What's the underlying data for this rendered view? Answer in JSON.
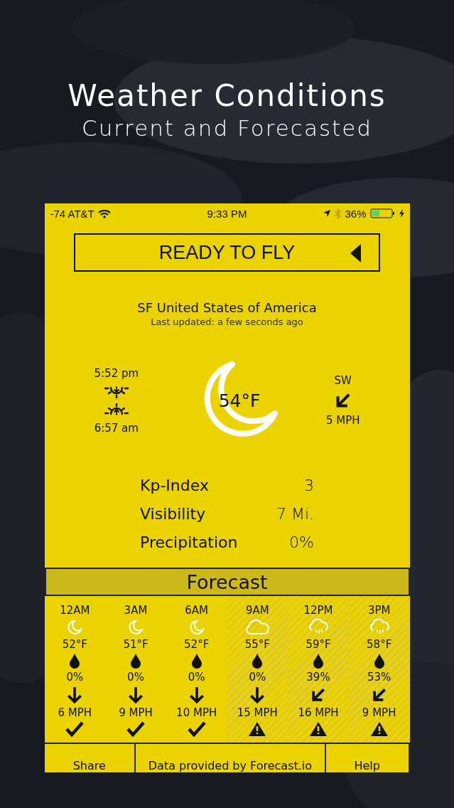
{
  "header": {
    "title": "Weather Conditions",
    "subtitle": "Current and Forecasted"
  },
  "status_bar": {
    "carrier": "-74 AT&T",
    "time": "9:33 PM",
    "battery": "36%"
  },
  "ready_button": {
    "label": "READY TO FLY"
  },
  "location": {
    "name": "SF United States of America",
    "updated": "Last updated: a few seconds ago"
  },
  "current": {
    "kind": "night",
    "sunset": "5:52 pm",
    "sunrise": "6:57 am",
    "temperature": "54°F",
    "wind": {
      "kind": "southwest",
      "direction": "SW",
      "speed": "5 MPH"
    }
  },
  "stats": [
    {
      "label": "Kp-Index",
      "value": "3"
    },
    {
      "label": "Visibility",
      "value": "7 Mi."
    },
    {
      "label": "Precipitation",
      "value": "0%"
    }
  ],
  "forecast": {
    "title": "Forecast",
    "hours": [
      {
        "kind": "night",
        "time": "12AM",
        "temp": "52°F",
        "precip": "0%",
        "wind": {
          "kind": "south",
          "speed": "6 MPH"
        },
        "caution": false
      },
      {
        "kind": "night",
        "time": "3AM",
        "temp": "51°F",
        "precip": "0%",
        "wind": {
          "kind": "south",
          "speed": "9 MPH"
        },
        "caution": false
      },
      {
        "kind": "night",
        "time": "6AM",
        "temp": "52°F",
        "precip": "0%",
        "wind": {
          "kind": "south",
          "speed": "10 MPH"
        },
        "caution": false
      },
      {
        "kind": "cloudy",
        "time": "9AM",
        "temp": "55°F",
        "precip": "0%",
        "wind": {
          "kind": "south",
          "speed": "15 MPH"
        },
        "caution": true
      },
      {
        "kind": "rainy",
        "time": "12PM",
        "temp": "59°F",
        "precip": "39%",
        "wind": {
          "kind": "southwest",
          "speed": "16 MPH"
        },
        "caution": true
      },
      {
        "kind": "rainy",
        "time": "3PM",
        "temp": "58°F",
        "precip": "53%",
        "wind": {
          "kind": "southwest",
          "speed": "9 MPH"
        },
        "caution": true
      }
    ]
  },
  "footer": [
    "Share",
    "Data provided by Forecast.io",
    "Help"
  ]
}
